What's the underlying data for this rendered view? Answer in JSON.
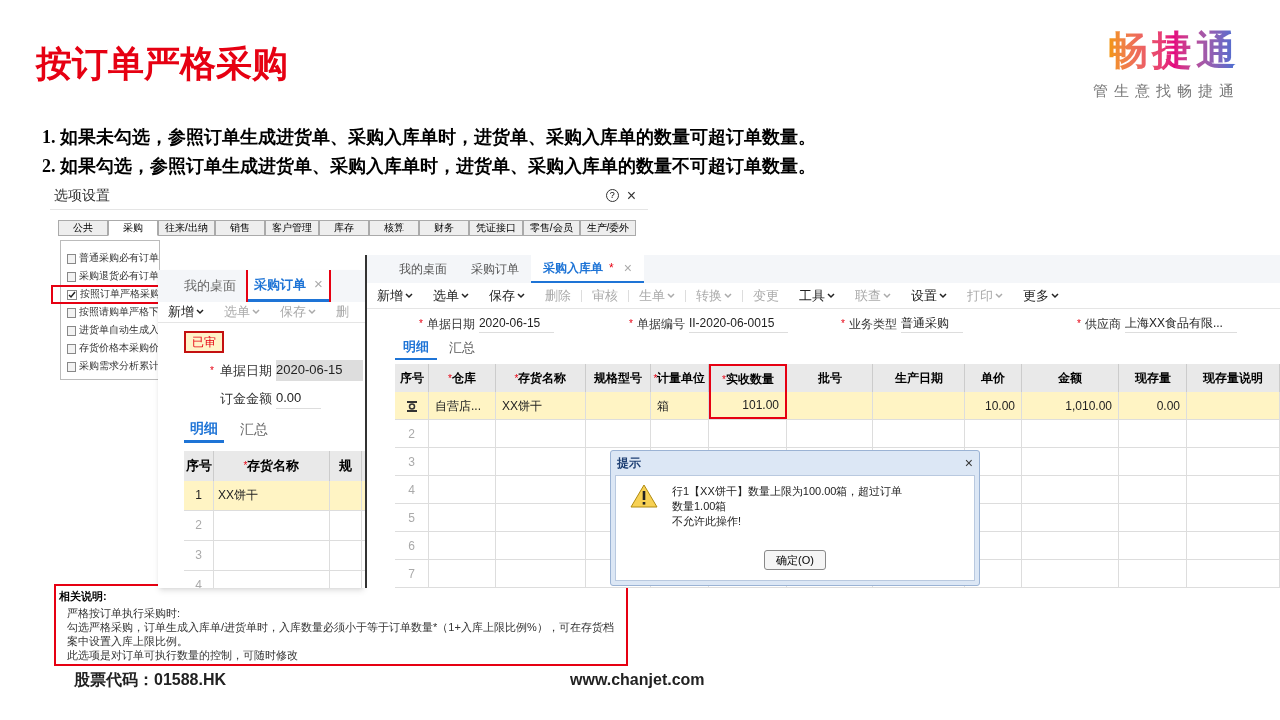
{
  "slide": {
    "title": "按订单严格采购",
    "logo": {
      "mark": "畅捷通",
      "slogan": "管生意找畅捷通"
    },
    "notes": [
      "1. 如果未勾选，参照订单生成进货单、采购入库单时，进货单、采购入库单的数量可超订单数量。",
      "2. 如果勾选，参照订单生成进货单、采购入库单时，进货单、采购入库单的数量不可超订单数量。"
    ],
    "footer": {
      "stock_code": "股票代码：01588.HK",
      "website": "www.chanjet.com"
    }
  },
  "options_dialog": {
    "title": "选项设置",
    "help": "?",
    "close": "×",
    "tabs": [
      {
        "label": "公共",
        "selected": false
      },
      {
        "label": "采购",
        "selected": true
      },
      {
        "label": "往来/出纳",
        "selected": false
      },
      {
        "label": "销售",
        "selected": false
      },
      {
        "label": "客户管理",
        "selected": false
      },
      {
        "label": "库存",
        "selected": false
      },
      {
        "label": "核算",
        "selected": false
      },
      {
        "label": "财务",
        "selected": false
      },
      {
        "label": "凭证接口",
        "selected": false
      },
      {
        "label": "零售/会员",
        "selected": false
      },
      {
        "label": "生产/委外",
        "selected": false
      }
    ],
    "options": [
      {
        "label": "普通采购必有订单",
        "checked": false,
        "highlighted": false
      },
      {
        "label": "采购退货必有订单",
        "checked": false,
        "highlighted": false
      },
      {
        "label": "按照订单严格采购",
        "checked": true,
        "highlighted": true
      },
      {
        "label": "按照请购单严格下",
        "checked": false,
        "highlighted": false
      },
      {
        "label": "进货单自动生成入",
        "checked": false,
        "highlighted": false
      },
      {
        "label": "存货价格本采购价",
        "checked": false,
        "highlighted": false
      },
      {
        "label": "采购需求分析累计",
        "checked": false,
        "highlighted": false
      }
    ],
    "related": {
      "heading": "相关说明:",
      "lines": [
        "严格按订单执行采购时:",
        "勾选严格采购，订单生成入库单/进货单时，入库数量必须小于等于订单数量*（1+入库上限比例%），可在存货档案中设置入库上限比例。",
        "此选项是对订单可执行数量的控制，可随时修改"
      ]
    }
  },
  "purchase_order": {
    "tabs": [
      {
        "label": "我的桌面",
        "selected": false,
        "highlighted": false
      },
      {
        "label": "采购订单",
        "selected": true,
        "close": "×",
        "highlighted": true
      }
    ],
    "toolbar": [
      {
        "label": "新增",
        "disabled": false,
        "menu": true
      },
      {
        "label": "选单",
        "disabled": true,
        "menu": true
      },
      {
        "label": "保存",
        "disabled": true,
        "menu": true
      },
      {
        "label": "删",
        "disabled": true,
        "menu": false
      }
    ],
    "badge": "已审",
    "fields": [
      {
        "mark": "*",
        "label": "单据日期",
        "value": "2020-06-15"
      },
      {
        "label": "订金金额",
        "value": "0.00"
      }
    ],
    "subtabs": [
      {
        "label": "明细",
        "selected": true
      },
      {
        "label": "汇总",
        "selected": false
      }
    ],
    "columns": [
      {
        "label": "序号"
      },
      {
        "mark": "*",
        "label": "存货名称"
      },
      {
        "label": "规"
      }
    ],
    "rows": [
      {
        "cells": [
          "1",
          "XX饼干",
          ""
        ],
        "selected": true
      },
      {
        "cells": [
          "2",
          "",
          ""
        ],
        "selected": false
      },
      {
        "cells": [
          "3",
          "",
          ""
        ],
        "selected": false
      },
      {
        "cells": [
          "4",
          "",
          ""
        ],
        "selected": false
      }
    ]
  },
  "receipt": {
    "tabs": [
      {
        "label": "我的桌面",
        "selected": false
      },
      {
        "label": "采购订单",
        "selected": false
      },
      {
        "label": "采购入库单",
        "selected": true,
        "modified_mark": "*",
        "close": "×"
      }
    ],
    "toolbar": [
      {
        "label": "新增",
        "disabled": false,
        "menu": true
      },
      {
        "label": "选单",
        "disabled": false,
        "menu": true
      },
      {
        "label": "保存",
        "disabled": false,
        "menu": true
      },
      {
        "label": "删除",
        "disabled": true,
        "menu": false
      },
      {
        "label": "审核",
        "disabled": true,
        "menu": false
      },
      {
        "label": "生单",
        "disabled": true,
        "menu": true
      },
      {
        "label": "转换",
        "disabled": true,
        "menu": true
      },
      {
        "label": "变更",
        "disabled": true,
        "menu": false
      },
      {
        "label": "工具",
        "disabled": false,
        "menu": true
      },
      {
        "label": "联查",
        "disabled": true,
        "menu": true
      },
      {
        "label": "设置",
        "disabled": false,
        "menu": true
      },
      {
        "label": "打印",
        "disabled": true,
        "menu": true
      },
      {
        "label": "更多",
        "disabled": false,
        "menu": true
      }
    ],
    "fields": [
      {
        "mark": "*",
        "label": "单据日期",
        "value": "2020-06-15"
      },
      {
        "mark": "*",
        "label": "单据编号",
        "value": "II-2020-06-0015"
      },
      {
        "mark": "*",
        "label": "业务类型",
        "value": "普通采购"
      },
      {
        "mark": "*",
        "label": "供应商",
        "value": "上海XX食品有限..."
      }
    ],
    "subtabs": [
      {
        "label": "明细",
        "selected": true
      },
      {
        "label": "汇总",
        "selected": false
      }
    ],
    "columns": [
      {
        "label": "序号",
        "highlighted": false
      },
      {
        "mark": "*",
        "label": "仓库",
        "highlighted": false
      },
      {
        "mark": "*",
        "label": "存货名称",
        "highlighted": false
      },
      {
        "label": "规格型号",
        "highlighted": false
      },
      {
        "mark": "*",
        "label": "计量单位",
        "highlighted": false
      },
      {
        "mark": "*",
        "label": "实收数量",
        "highlighted": true
      },
      {
        "label": "批号",
        "highlighted": false
      },
      {
        "label": "生产日期",
        "highlighted": false
      },
      {
        "label": "单价",
        "highlighted": false
      },
      {
        "label": "金额",
        "highlighted": false
      },
      {
        "label": "现存量",
        "highlighted": false
      },
      {
        "label": "现存量说明",
        "highlighted": false
      }
    ],
    "rows": [
      {
        "kind": "filled",
        "selected": true,
        "cells": [
          "",
          "自营店...",
          "XX饼干",
          "",
          "箱",
          "101.00",
          "",
          "",
          "10.00",
          "1,010.00",
          "0.00",
          ""
        ]
      },
      {
        "kind": "empty",
        "selected": false,
        "cells": [
          "2",
          "",
          "",
          "",
          "",
          "",
          "",
          "",
          "",
          "",
          "",
          ""
        ]
      },
      {
        "kind": "empty",
        "selected": false,
        "cells": [
          "3",
          "",
          "",
          "",
          "",
          "",
          "",
          "",
          "",
          "",
          "",
          ""
        ]
      },
      {
        "kind": "empty",
        "selected": false,
        "cells": [
          "4",
          "",
          "",
          "",
          "",
          "",
          "",
          "",
          "",
          "",
          "",
          ""
        ]
      },
      {
        "kind": "empty",
        "selected": false,
        "cells": [
          "5",
          "",
          "",
          "",
          "",
          "",
          "",
          "",
          "",
          "",
          "",
          ""
        ]
      },
      {
        "kind": "empty",
        "selected": false,
        "cells": [
          "6",
          "",
          "",
          "",
          "",
          "",
          "",
          "",
          "",
          "",
          "",
          ""
        ]
      },
      {
        "kind": "empty",
        "selected": false,
        "cells": [
          "7",
          "",
          "",
          "",
          "",
          "",
          "",
          "",
          "",
          "",
          "",
          ""
        ]
      }
    ]
  },
  "alert": {
    "title": "提示",
    "close": "×",
    "message": [
      "行1【XX饼干】数量上限为100.00箱，超过订单数量1.00箱",
      "不允许此操作!"
    ],
    "button": "确定(O)"
  }
}
